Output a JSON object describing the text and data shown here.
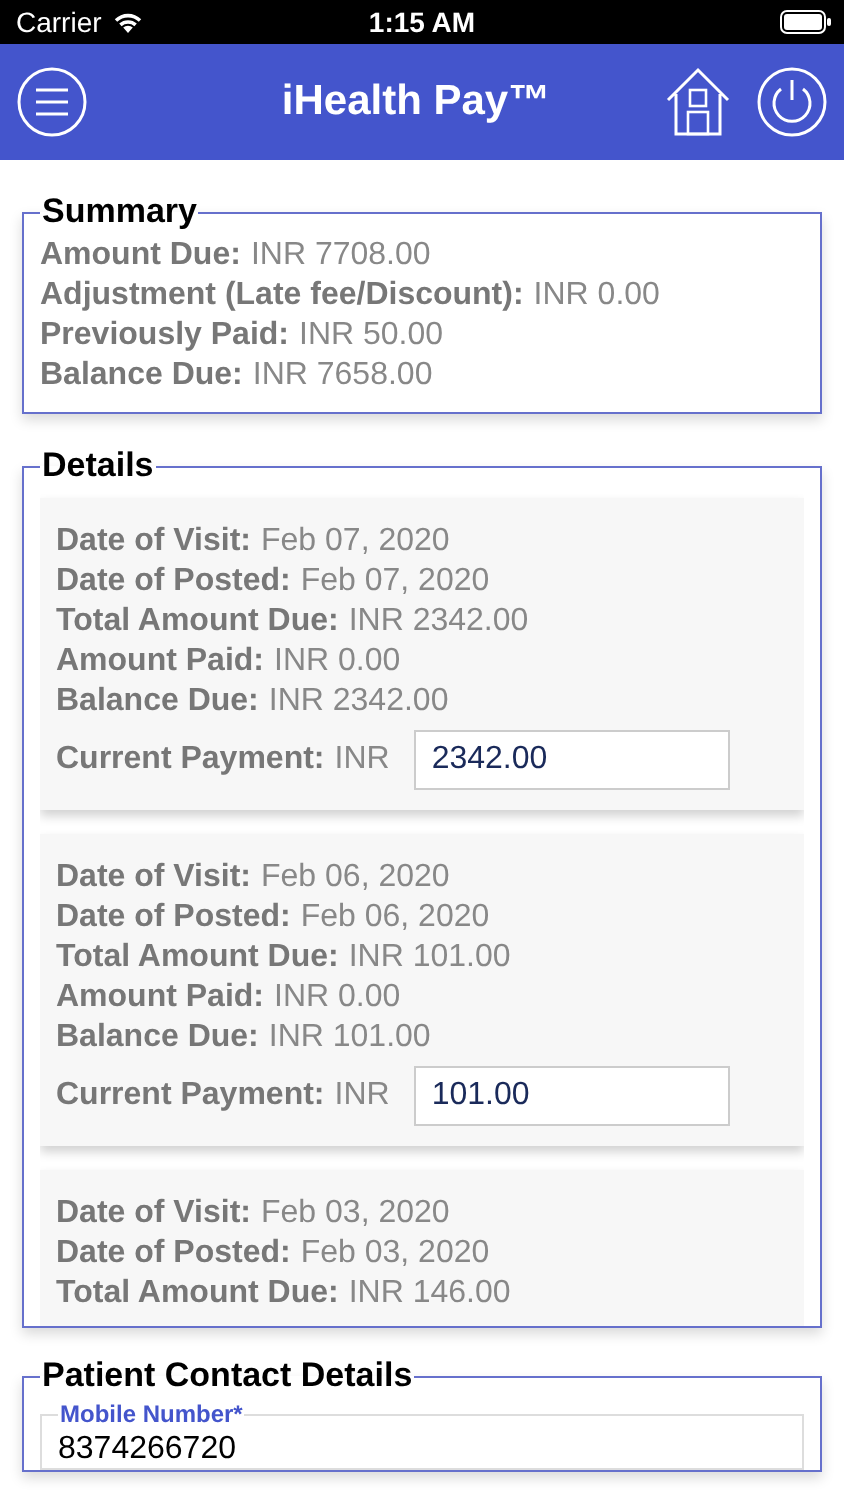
{
  "status_bar": {
    "carrier": "Carrier",
    "time": "1:15 AM"
  },
  "header": {
    "title": "iHealth Pay™"
  },
  "summary": {
    "title": "Summary",
    "rows": [
      {
        "label": "Amount Due:",
        "value": "INR 7708.00"
      },
      {
        "label": "Adjustment (Late fee/Discount):",
        "value": "INR 0.00"
      },
      {
        "label": "Previously Paid:",
        "value": "INR 50.00"
      },
      {
        "label": "Balance Due:",
        "value": "INR 7658.00"
      }
    ]
  },
  "details": {
    "title": "Details",
    "items": [
      {
        "rows": [
          {
            "label": "Date of Visit:",
            "value": "Feb 07, 2020"
          },
          {
            "label": "Date of Posted:",
            "value": "Feb 07, 2020"
          },
          {
            "label": "Total Amount Due:",
            "value": "INR 2342.00"
          },
          {
            "label": "Amount Paid:",
            "value": "INR 0.00"
          },
          {
            "label": "Balance Due:",
            "value": "INR 2342.00"
          }
        ],
        "payment": {
          "label": "Current Payment:",
          "currency": "INR",
          "value": "2342.00"
        }
      },
      {
        "rows": [
          {
            "label": "Date of Visit:",
            "value": "Feb 06, 2020"
          },
          {
            "label": "Date of Posted:",
            "value": "Feb 06, 2020"
          },
          {
            "label": "Total Amount Due:",
            "value": "INR 101.00"
          },
          {
            "label": "Amount Paid:",
            "value": "INR 0.00"
          },
          {
            "label": "Balance Due:",
            "value": "INR 101.00"
          }
        ],
        "payment": {
          "label": "Current Payment:",
          "currency": "INR",
          "value": "101.00"
        }
      },
      {
        "rows": [
          {
            "label": "Date of Visit:",
            "value": "Feb 03, 2020"
          },
          {
            "label": "Date of Posted:",
            "value": "Feb 03, 2020"
          },
          {
            "label": "Total Amount Due:",
            "value": "INR 146.00"
          }
        ]
      }
    ]
  },
  "contact": {
    "title": "Patient Contact Details",
    "fields": [
      {
        "label": "Mobile Number*",
        "value": "8374266720"
      }
    ]
  }
}
